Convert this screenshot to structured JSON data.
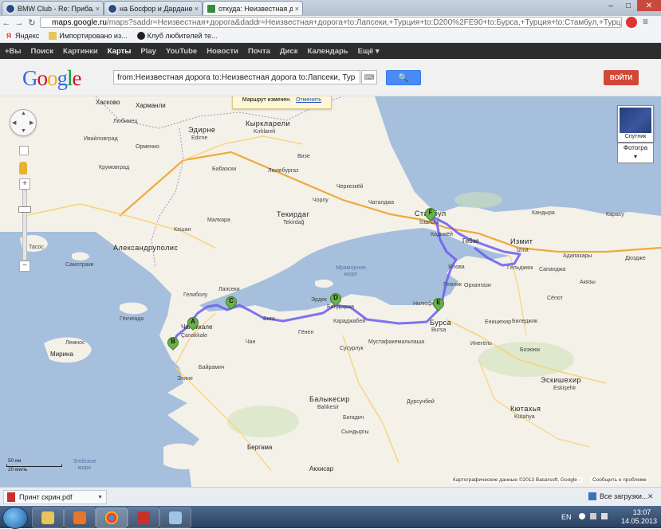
{
  "tabs": [
    {
      "title": "BMW Club - Re: Прибалт",
      "close": "×"
    },
    {
      "title": "на Босфор и Дарданелл",
      "close": "×"
    },
    {
      "title": "откуда: Неизвестная дорог",
      "close": "×"
    }
  ],
  "window_controls": {
    "minimize": "–",
    "maximize": "□",
    "close": "✕"
  },
  "toolbar": {
    "back": "←",
    "forward": "→",
    "reload": "↻"
  },
  "url": {
    "domain": "maps.google.ru",
    "rest": "/maps?saddr=Неизвестная+дорога&daddr=Неизвестная+дорога+to:Лапсеки,+Турция+to:D200%2FE90+to:Бурса,+Турция+to:Стамбул,+Турци"
  },
  "bookmarks": [
    {
      "label": "Яндекс",
      "icon": "yandex-icon"
    },
    {
      "label": "Импортировано из...",
      "icon": "folder-icon"
    },
    {
      "label": "Клуб любителей те...",
      "icon": "bmw-icon"
    }
  ],
  "gbar": [
    "+Вы",
    "Поиск",
    "Картинки",
    "Карты",
    "Play",
    "YouTube",
    "Новости",
    "Почта",
    "Диск",
    "Календарь",
    "Ещё ▾"
  ],
  "gbar_active": "Карты",
  "search": {
    "value": "from:Неизвестная дорога to:Неизвестная дорога to:Лапсеки, Тур",
    "button": "🔍",
    "keyboard": "⌨"
  },
  "login_button": "ВОЙТИ",
  "notice": {
    "text": "Маршрут изменен.",
    "undo": "Отменить"
  },
  "map_controls": {
    "zoom_in": "+",
    "zoom_out": "−",
    "satellite": "Спутник",
    "photos": "Фотогра"
  },
  "scale": {
    "km": "50 км",
    "mi": "20 миль"
  },
  "attribution": "Картографические данные ©2013 Basarsoft, Google -",
  "report_problem": "Сообщить о проблеме",
  "markers": [
    "A",
    "B",
    "C",
    "D",
    "E",
    "F"
  ],
  "map_labels": {
    "haskovo": "Хасково",
    "harmanli": "Харманли",
    "kyrklareli": "Кыркларели",
    "kirklareli": "Kırklareli",
    "edirne": "Эдирне",
    "edirne_lat": "Edirne",
    "lyubimets": "Любимец",
    "ivailovgrad": "Ивайловград",
    "krumovgrad": "Крумовград",
    "ormenio": "Орменио",
    "vize": "Визе",
    "babaeski": "Бабаэски",
    "luleburgaz": "Люлебургаз",
    "corlu": "Чорлу",
    "cerkezkoy": "Черкезкёй",
    "catalca": "Чаталджа",
    "tekirdag": "Текирдаг",
    "tekirdag_lat": "Tekirdağ",
    "malkara": "Малкара",
    "kesan": "Кешан",
    "alexandroupolis": "Александруполис",
    "samothraki": "Самотраки",
    "thasos": "Тасос",
    "gelibolu": "Гелиболу",
    "lapseki": "Лапсеки",
    "canakkale": "Чанаккале",
    "canakkale_lat": "Çanakkale",
    "bayramic": "Байрамич",
    "ezine": "Эзине",
    "can": "Чан",
    "biga": "Бига",
    "gonen": "Гёнен",
    "erdek": "Эрдек",
    "bandirma": "Бандырма",
    "karacabey": "Караджабей",
    "mustafakemalpasa": "Мустафакемальпаша",
    "susurluk": "Сусурлук",
    "balikesir": "Балыкесир",
    "balikesir_lat": "Balıkesir",
    "bigadic": "Бигадич",
    "sindirgi": "Сындыргы",
    "dursunbey": "Дурсунбей",
    "bergama": "Бергама",
    "akhisar": "Акхисар",
    "nilufer": "Нилюфер",
    "bursa": "Бурса",
    "bursa_lat": "Bursa",
    "yenisehir": "Енишехир",
    "inegol": "Инегёль",
    "bilecik": "Биледжик",
    "sogut": "Сёгют",
    "bozuyuk": "Бозююк",
    "eskisehir": "Эскишехир",
    "eskisehir_lat": "Eskişehir",
    "kutahya": "Кютахья",
    "kutahya_lat": "Kütahya",
    "gemlik": "Гемлик",
    "orhangazi": "Орхангази",
    "yalova": "Ялова",
    "istanbul": "Стамбул",
    "istanbul_lat": "İstanbul",
    "kadikoy": "Кадыкёй",
    "gebze": "Гебзе",
    "izmit": "Измит",
    "izmit_lat": "İzmit",
    "golcuk": "Гёльджюк",
    "sapanca": "Сапанджа",
    "adapazari": "Адапазары",
    "akyazi": "Акязы",
    "duzce": "Дюздже",
    "kandira": "Кандыра",
    "karasu": "Карасу",
    "marmara_sea": "Мраморное море",
    "aegean_sea": "Эгейское море",
    "mirina": "Мирина",
    "lemnos": "Лемнос",
    "imbros": "Гёкчеада"
  },
  "downloads": {
    "file": "Принт скрин.pdf",
    "all": "Все загрузки...",
    "close": "✕"
  },
  "taskbar": {
    "lang": "EN",
    "time": "13:07",
    "date": "14.05.2013"
  },
  "colors": {
    "route": "#6a5cf2",
    "water": "#a5bfdd",
    "land": "#f4f1e9",
    "highway": "#f0a93c"
  }
}
